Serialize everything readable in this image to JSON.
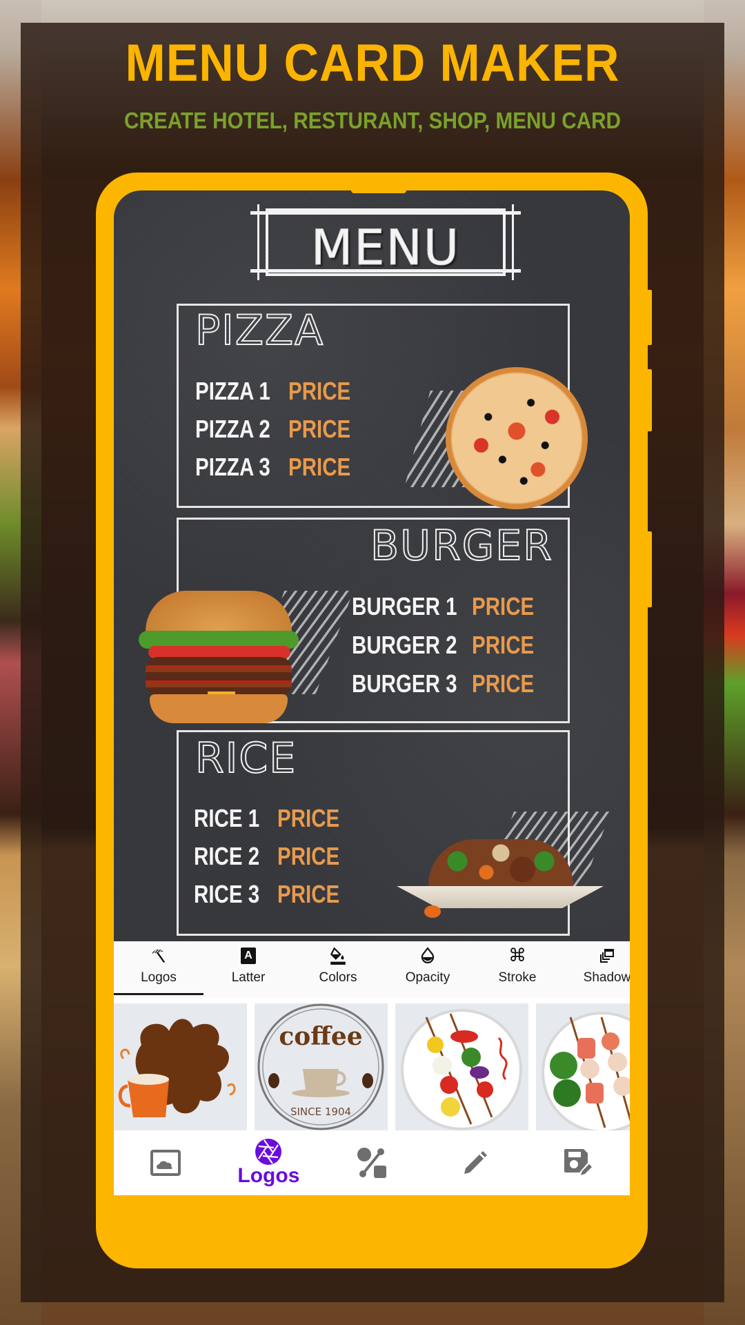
{
  "promo": {
    "title": "MENU CARD MAKER",
    "subtitle": "CREATE HOTEL, RESTURANT, SHOP, MENU CARD",
    "title_color": "#fbb400",
    "subtitle_color": "#7aa22a",
    "phone_frame_color": "#fdb600"
  },
  "menu_card": {
    "heading": "MENU",
    "sections": [
      {
        "title": "PIZZA",
        "image": "pizza",
        "items": [
          {
            "name": "PIZZA 1",
            "price": "PRICE"
          },
          {
            "name": "PIZZA 2",
            "price": "PRICE"
          },
          {
            "name": "PIZZA 3",
            "price": "PRICE"
          }
        ]
      },
      {
        "title": "BURGER",
        "image": "burger",
        "items": [
          {
            "name": "BURGER 1",
            "price": "PRICE"
          },
          {
            "name": "BURGER 2",
            "price": "PRICE"
          },
          {
            "name": "BURGER 3",
            "price": "PRICE"
          }
        ]
      },
      {
        "title": "RICE",
        "image": "rice-bowl",
        "items": [
          {
            "name": "RICE 1",
            "price": "PRICE"
          },
          {
            "name": "RICE 2",
            "price": "PRICE"
          },
          {
            "name": "RICE 3",
            "price": "PRICE"
          }
        ]
      }
    ],
    "price_color": "#e89a4c"
  },
  "editor_tabs": [
    {
      "label": "Logos",
      "icon": "beach-umbrella-icon",
      "active": true
    },
    {
      "label": "Latter",
      "icon": "letter-a-icon",
      "active": false
    },
    {
      "label": "Colors",
      "icon": "paint-bucket-icon",
      "active": false
    },
    {
      "label": "Opacity",
      "icon": "opacity-drop-icon",
      "active": false
    },
    {
      "label": "Stroke",
      "icon": "command-icon",
      "active": false
    },
    {
      "label": "Shadow",
      "icon": "layers-icon",
      "active": false
    }
  ],
  "logo_thumbnails": [
    {
      "name": "coffee-splash"
    },
    {
      "name": "coffee-badge",
      "text_top": "coffee",
      "text_bottom": "SINCE 1904"
    },
    {
      "name": "veggie-skewer-plate"
    },
    {
      "name": "meat-veggie-skewer-plate"
    }
  ],
  "bottom_nav": [
    {
      "icon": "image-icon",
      "label": ""
    },
    {
      "icon": "aperture-icon",
      "label": "Logos",
      "active": true
    },
    {
      "icon": "shapes-icon",
      "label": ""
    },
    {
      "icon": "pencil-icon",
      "label": ""
    },
    {
      "icon": "save-edit-icon",
      "label": ""
    }
  ],
  "accent_color": "#6a0be0"
}
